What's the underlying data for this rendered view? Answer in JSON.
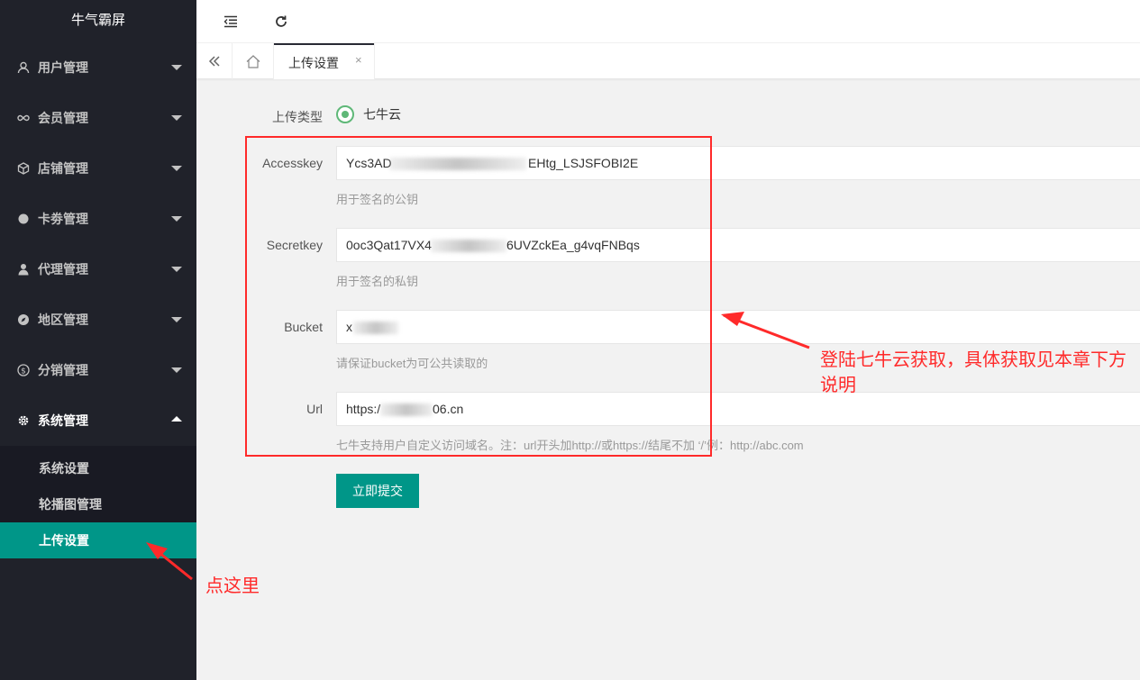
{
  "app": {
    "title": "牛气霸屏"
  },
  "sidebar": {
    "items": [
      {
        "label": "用户管理",
        "icon": "user-icon"
      },
      {
        "label": "会员管理",
        "icon": "infinity-icon"
      },
      {
        "label": "店铺管理",
        "icon": "cube-icon"
      },
      {
        "label": "卡劵管理",
        "icon": "circle-icon"
      },
      {
        "label": "代理管理",
        "icon": "person-icon"
      },
      {
        "label": "地区管理",
        "icon": "compass-icon"
      },
      {
        "label": "分销管理",
        "icon": "dollar-icon"
      },
      {
        "label": "系统管理",
        "icon": "gear-icon"
      }
    ],
    "subitems": [
      {
        "label": "系统设置"
      },
      {
        "label": "轮播图管理"
      },
      {
        "label": "上传设置"
      }
    ]
  },
  "tabs": {
    "active_label": "上传设置",
    "close_glyph": "×"
  },
  "form": {
    "upload_type": {
      "label": "上传类型",
      "option": "七牛云"
    },
    "accesskey": {
      "label": "Accesskey",
      "value_start": "Ycs3AD",
      "value_end": "EHtg_LSJSFOBI2E",
      "help": "用于签名的公钥"
    },
    "secretkey": {
      "label": "Secretkey",
      "value_start": "0oc3Qat17VX4",
      "value_end": "6UVZckEa_g4vqFNBqs",
      "help": "用于签名的私钥"
    },
    "bucket": {
      "label": "Bucket",
      "value_start": "x",
      "help": "请保证bucket为可公共读取的"
    },
    "url": {
      "label": "Url",
      "value_start": "https:/",
      "value_end": "06.cn",
      "help": "七牛支持用户自定义访问域名。注：url开头加http://或https://结尾不加 ‘/’例：http://abc.com"
    },
    "submit_label": "立即提交"
  },
  "annotations": {
    "right_note": "登陆七牛云获取，具体获取见本章下方说明",
    "bottom_note": "点这里"
  },
  "colors": {
    "sidebar_bg": "#20222a",
    "accent": "#009688",
    "radio": "#5fb878",
    "annotation": "#ff2a2a"
  }
}
